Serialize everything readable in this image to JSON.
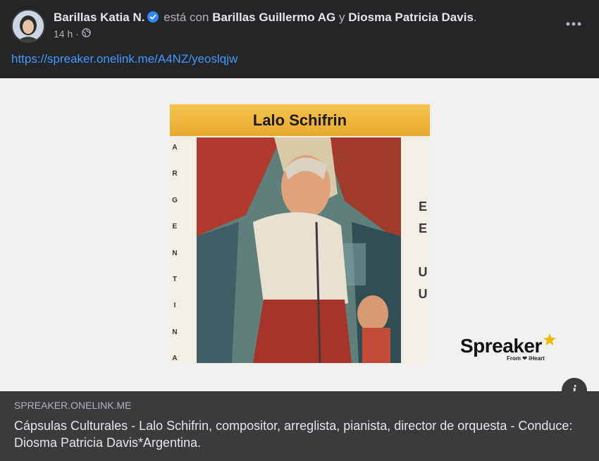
{
  "post": {
    "author": "Barillas Katia N.",
    "with_text": "está con",
    "tagged_1": "Barillas Guillermo AG",
    "conj": "y",
    "tagged_2": "Diosma Patricia Davis",
    "period": ".",
    "time": "14 h",
    "separator": "·",
    "audience_icon": "globe-icon",
    "link": "https://spreaker.onelink.me/A4NZ/yeoslqjw"
  },
  "cover": {
    "title": "Lalo Schifrin",
    "left_letters": [
      "A",
      "R",
      "G",
      "E",
      "N",
      "T",
      "I",
      "N",
      "A"
    ],
    "right_letters": [
      "E",
      "E",
      "",
      "U",
      "U"
    ]
  },
  "brand": {
    "name": "Spreaker",
    "sub": "From ❤ iHeart"
  },
  "preview": {
    "domain": "SPREAKER.ONELINK.ME",
    "title": "Cápsulas Culturales - Lalo Schifrin, compositor, arreglista, pianista, director de orquesta - Conduce: Diosma Patricia Davis*Argentina."
  },
  "info_label": "i",
  "colors": {
    "link": "#4599ff",
    "verified": "#2d88ff",
    "star": "#f5b800"
  }
}
